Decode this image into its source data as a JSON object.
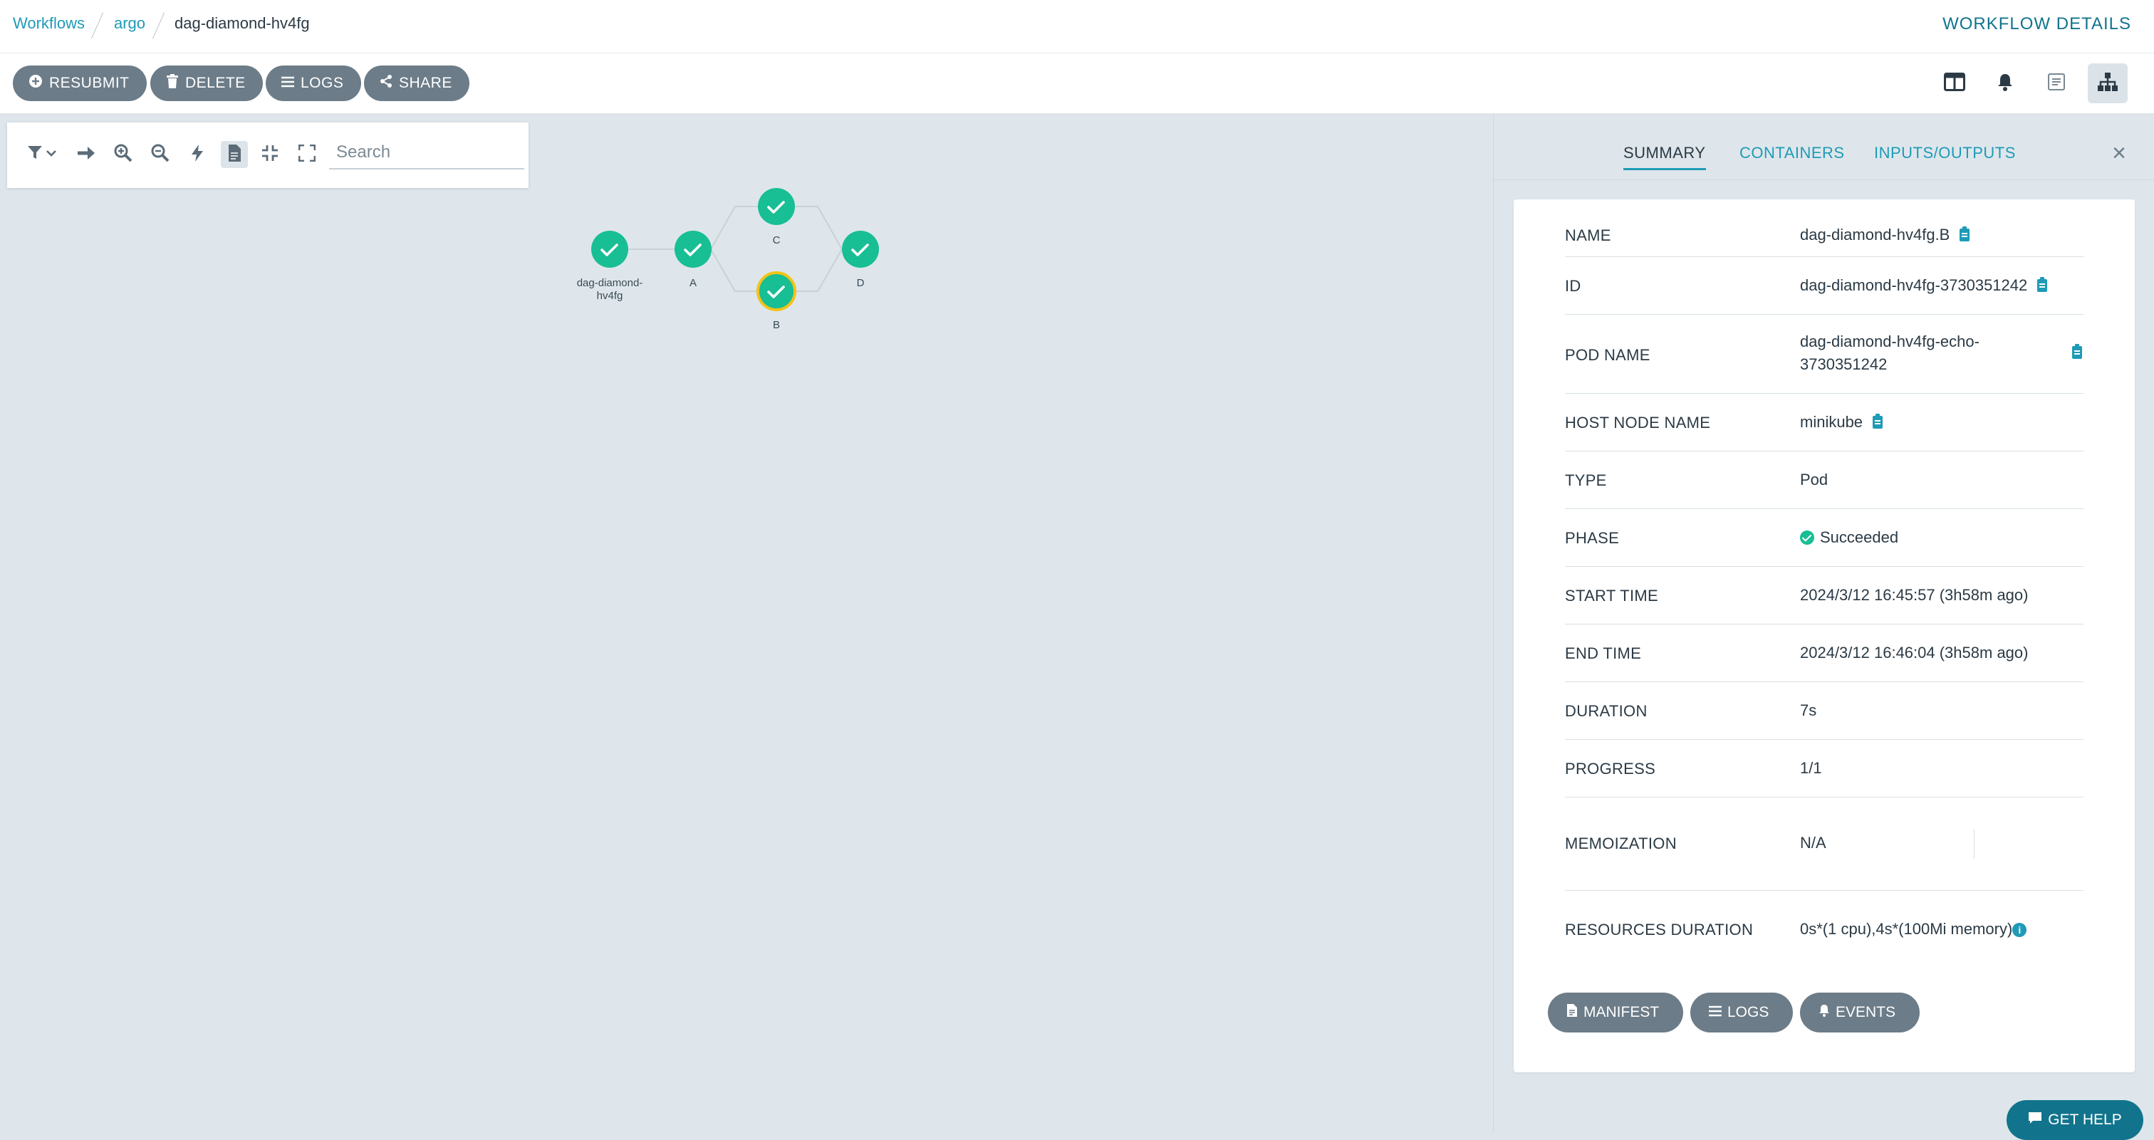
{
  "breadcrumb": {
    "items": [
      "Workflows",
      "argo"
    ],
    "current": "dag-diamond-hv4fg"
  },
  "page_title": "WORKFLOW DETAILS",
  "toolbar": {
    "resubmit": "RESUBMIT",
    "delete": "DELETE",
    "logs": "LOGS",
    "share": "SHARE"
  },
  "graph": {
    "search_placeholder": "Search",
    "nodes": [
      {
        "label_line1": "dag-diamond-",
        "label_line2": "hv4fg",
        "status": "succeeded"
      },
      {
        "label_line1": "A",
        "label_line2": "",
        "status": "succeeded"
      },
      {
        "label_line1": "C",
        "label_line2": "",
        "status": "succeeded"
      },
      {
        "label_line1": "B",
        "label_line2": "",
        "status": "succeeded",
        "selected": true
      },
      {
        "label_line1": "D",
        "label_line2": "",
        "status": "succeeded"
      }
    ]
  },
  "panel": {
    "tabs": [
      "SUMMARY",
      "CONTAINERS",
      "INPUTS/OUTPUTS"
    ],
    "active_tab": "SUMMARY",
    "rows": [
      {
        "key": "NAME",
        "value": "dag-diamond-hv4fg.B"
      },
      {
        "key": "ID",
        "value": "dag-diamond-hv4fg-3730351242"
      },
      {
        "key": "POD NAME",
        "value_line1": "dag-diamond-hv4fg-echo-",
        "value_line2": "3730351242"
      },
      {
        "key": "HOST NODE NAME",
        "value": "minikube"
      },
      {
        "key": "TYPE",
        "value": "Pod"
      },
      {
        "key": "PHASE",
        "value": "Succeeded"
      },
      {
        "key": "START TIME",
        "value": "2024/3/12 16:45:57 (3h58m ago)"
      },
      {
        "key": "END TIME",
        "value": "2024/3/12 16:46:04 (3h58m ago)"
      },
      {
        "key": "DURATION",
        "value": "7s"
      },
      {
        "key": "PROGRESS",
        "value": "1/1"
      },
      {
        "key": "MEMOIZATION",
        "value": "N/A"
      },
      {
        "key": "RESOURCES DURATION",
        "value": "0s*(1 cpu),4s*(100Mi memory)"
      }
    ],
    "buttons": {
      "manifest": "MANIFEST",
      "logs": "LOGS",
      "events": "EVENTS"
    }
  },
  "help_button": "GET HELP",
  "colors": {
    "accent": "#1e9bb7",
    "success": "#18be94",
    "selected_ring": "#f2c318",
    "pill": "#6c7c88",
    "canvas": "#dee6eb"
  }
}
